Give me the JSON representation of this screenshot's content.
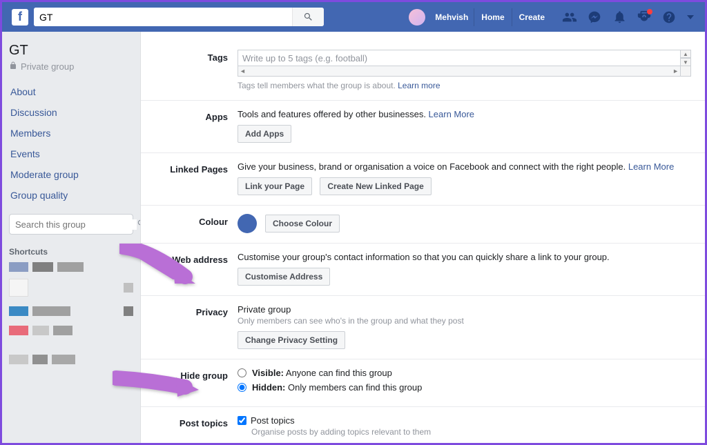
{
  "topbar": {
    "search_value": "GT",
    "user_name": "Mehvish",
    "home": "Home",
    "create": "Create"
  },
  "sidebar": {
    "title": "GT",
    "privacy_label": "Private group",
    "nav": [
      "About",
      "Discussion",
      "Members",
      "Events",
      "Moderate group",
      "Group quality"
    ],
    "search_placeholder": "Search this group",
    "shortcuts_heading": "Shortcuts"
  },
  "sections": {
    "tags": {
      "label": "Tags",
      "placeholder": "Write up to 5 tags (e.g. football)",
      "desc": "Tags tell members what the group is about. ",
      "link": "Learn more"
    },
    "apps": {
      "label": "Apps",
      "desc": "Tools and features offered by other businesses. ",
      "link": "Learn More",
      "btn": "Add Apps"
    },
    "linked": {
      "label": "Linked Pages",
      "desc": "Give your business, brand or organisation a voice on Facebook and connect with the right people. ",
      "link": "Learn More",
      "btn1": "Link your Page",
      "btn2": "Create New Linked Page"
    },
    "colour": {
      "label": "Colour",
      "btn": "Choose Colour"
    },
    "web": {
      "label": "Web address",
      "desc": "Customise your group's contact information so that you can quickly share a link to your group.",
      "btn": "Customise Address"
    },
    "privacy": {
      "label": "Privacy",
      "value": "Private group",
      "sub": "Only members can see who's in the group and what they post",
      "btn": "Change Privacy Setting"
    },
    "hide": {
      "label": "Hide group",
      "opt1_bold": "Visible:",
      "opt1_rest": " Anyone can find this group",
      "opt2_bold": "Hidden:",
      "opt2_rest": " Only members can find this group"
    },
    "topics": {
      "label": "Post topics",
      "check_label": "Post topics",
      "sub": "Organise posts by adding topics relevant to them"
    }
  }
}
